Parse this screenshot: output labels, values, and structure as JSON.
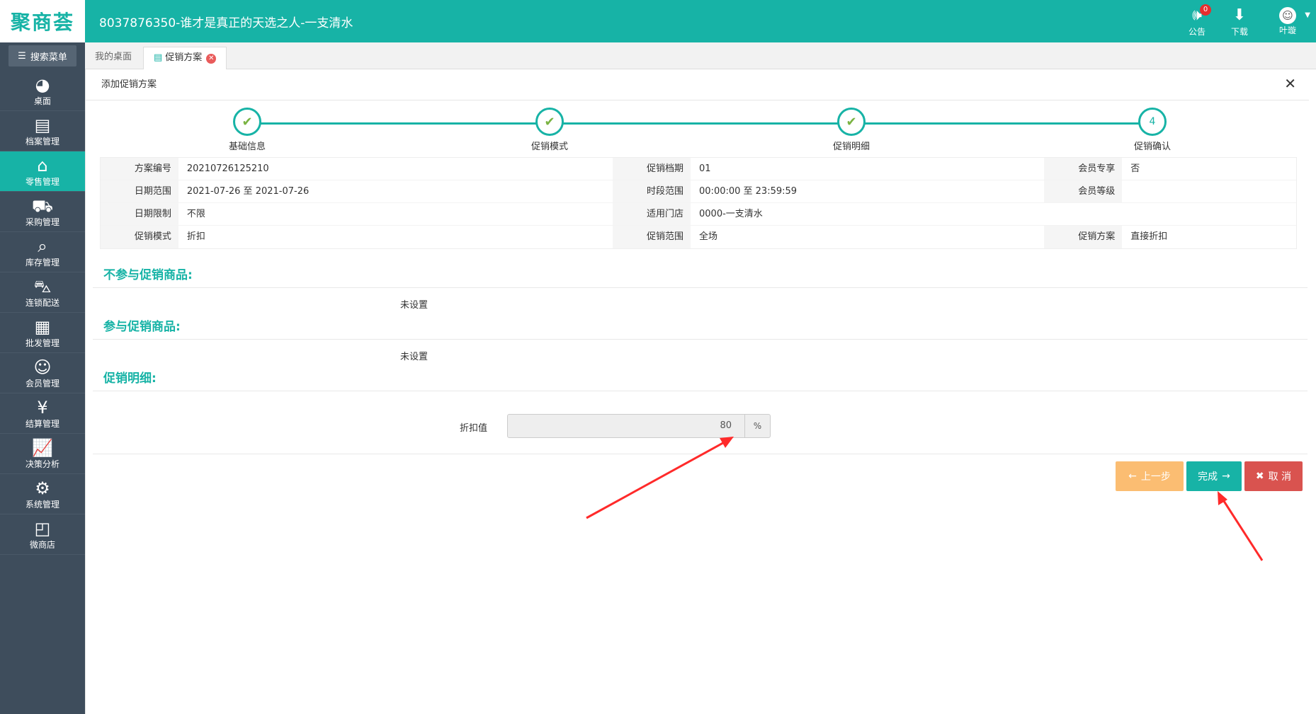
{
  "app": {
    "logo": "聚商荟",
    "title": "8037876350-谁才是真正的天选之人-一支清水"
  },
  "top_actions": {
    "notice_label": "公告",
    "notice_badge": "0",
    "download_label": "下载",
    "user_name": "叶璇"
  },
  "sidebar": {
    "search_label": "搜索菜单",
    "items": [
      {
        "label": "桌面",
        "icon": "dashboard-icon"
      },
      {
        "label": "档案管理",
        "icon": "archive-icon"
      },
      {
        "label": "零售管理",
        "icon": "store-icon"
      },
      {
        "label": "采购管理",
        "icon": "cart-icon"
      },
      {
        "label": "库存管理",
        "icon": "inventory-icon"
      },
      {
        "label": "连锁配送",
        "icon": "truck-icon"
      },
      {
        "label": "批发管理",
        "icon": "wholesale-icon"
      },
      {
        "label": "会员管理",
        "icon": "member-icon"
      },
      {
        "label": "结算管理",
        "icon": "yen-icon"
      },
      {
        "label": "决策分析",
        "icon": "chart-icon"
      },
      {
        "label": "系统管理",
        "icon": "gear-icon"
      },
      {
        "label": "微商店",
        "icon": "shop-bag-icon"
      }
    ]
  },
  "tabs": {
    "desktop": "我的桌面",
    "promo": "促销方案"
  },
  "panel": {
    "title": "添加促销方案"
  },
  "steps": [
    "基础信息",
    "促销模式",
    "促销明细",
    "促销确认"
  ],
  "step_number_last": "4",
  "info": {
    "r1": {
      "l1": "方案编号",
      "v1": "20210726125210",
      "l2": "促销档期",
      "v2": "01",
      "l3": "会员专享",
      "v3": "否"
    },
    "r2": {
      "l1": "日期范围",
      "v1": "2021-07-26 至 2021-07-26",
      "l2": "时段范围",
      "v2": "00:00:00 至 23:59:59",
      "l3": "会员等级",
      "v3": ""
    },
    "r3": {
      "l1": "日期限制",
      "v1": "不限",
      "l2": "适用门店",
      "v2": "0000-一支清水",
      "l3": "",
      "v3": ""
    },
    "r4": {
      "l1": "促销模式",
      "v1": "折扣",
      "l2": "促销范围",
      "v2": "全场",
      "l3": "促销方案",
      "v3": "直接折扣"
    }
  },
  "sections": {
    "exclude_title": "不参与促销商品:",
    "exclude_value": "未设置",
    "include_title": "参与促销商品:",
    "include_value": "未设置",
    "detail_title": "促销明细:"
  },
  "discount": {
    "label": "折扣值",
    "value": "80",
    "unit": "%"
  },
  "buttons": {
    "prev": "上一步",
    "done": "完成",
    "cancel": "取 消"
  }
}
